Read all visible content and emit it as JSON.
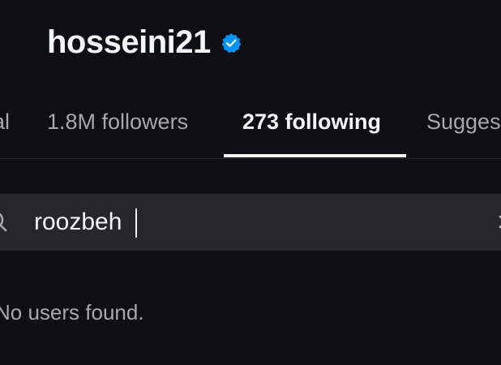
{
  "profile": {
    "username": "hosseini21",
    "verified_icon": "verified-badge-icon"
  },
  "tabs": [
    {
      "label": "Mutual",
      "active": false
    },
    {
      "label": "1.8M followers",
      "active": false
    },
    {
      "label": "273 following",
      "active": true
    },
    {
      "label": "Suggested",
      "active": false
    }
  ],
  "search": {
    "value": "roozbeh",
    "icon": "search-icon",
    "clear_icon": "clear-icon"
  },
  "results": {
    "empty_message": "No users found."
  },
  "colors": {
    "background": "#0c1014",
    "search_bg": "#24282d",
    "verified": "#0095f6",
    "text_primary": "#f5f5f5",
    "text_secondary": "#a8a8a8"
  }
}
